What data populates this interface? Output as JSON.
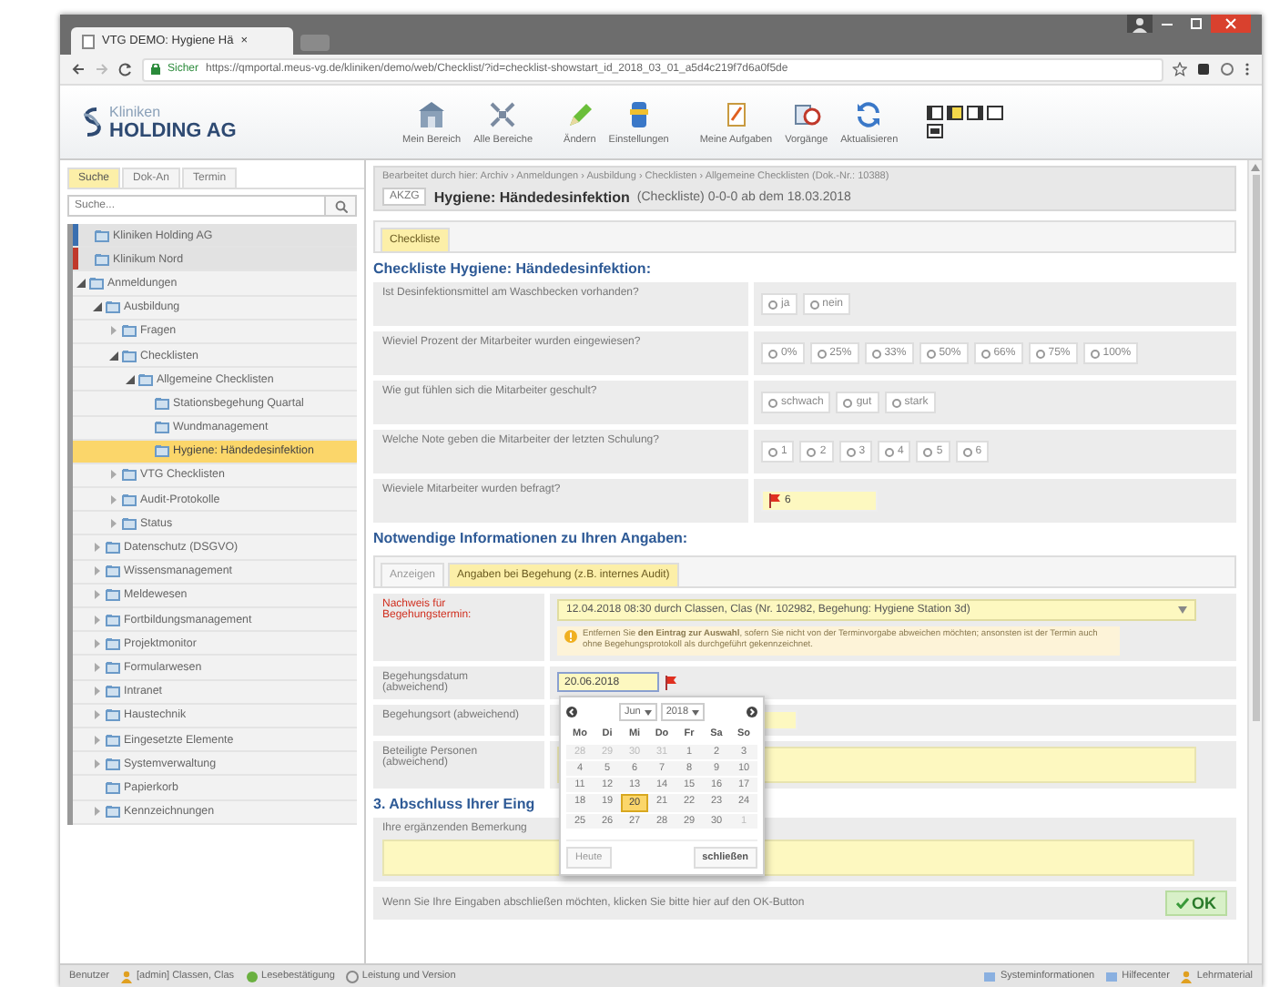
{
  "browser": {
    "tab_title": "VTG DEMO: Hygiene Hä",
    "tab_close": "×",
    "secure_label": "Sicher",
    "url": "https://qmportal.meus-vg.de/kliniken/demo/web/Checklist/?id=checklist-showstart_id_2018_03_01_a5d4c219f7d6a0f5de"
  },
  "header": {
    "logo_line1": "Kliniken",
    "logo_line2": "HOLDING AG",
    "toolbar": [
      {
        "label": "Mein Bereich"
      },
      {
        "label": "Alle Bereiche"
      },
      {
        "label": "Ändern"
      },
      {
        "label": "Einstellungen"
      },
      {
        "label": "Meine Aufgaben"
      },
      {
        "label": "Vorgänge"
      },
      {
        "label": "Aktualisieren"
      }
    ]
  },
  "sidebar": {
    "tabs": [
      {
        "label": "Suche",
        "selected": true
      },
      {
        "label": "Dok-An",
        "selected": false
      },
      {
        "label": "Termin",
        "selected": false
      }
    ],
    "search": {
      "placeholder": "Suche..."
    },
    "tree": [
      {
        "label": "Kliniken Holding AG",
        "selected": false,
        "color": "#3a6fb0"
      },
      {
        "label": "Klinikum Nord",
        "selected": false,
        "color": "#c0392b"
      },
      {
        "label": "Anmeldungen",
        "selected": false,
        "expanded": true,
        "children": [
          {
            "label": "Ausbildung",
            "selected": false,
            "expanded": true,
            "children": [
              {
                "label": "Fragen",
                "selected": false,
                "expanded": false
              },
              {
                "label": "Checklisten",
                "selected": false,
                "expanded": true,
                "children": [
                  {
                    "label": "Allgemeine Checklisten",
                    "selected": false,
                    "expanded": true,
                    "children": [
                      {
                        "label": "Stationsbegehung Quartal",
                        "selected": false
                      },
                      {
                        "label": "Wundmanagement",
                        "selected": false
                      },
                      {
                        "label": "Hygiene: Händedesinfektion",
                        "selected": true
                      }
                    ]
                  }
                ]
              },
              {
                "label": "VTG Checklisten",
                "selected": false,
                "expanded": false
              },
              {
                "label": "Audit-Protokolle",
                "selected": false,
                "expanded": false
              },
              {
                "label": "Status",
                "selected": false,
                "expanded": false
              }
            ]
          },
          {
            "label": "Datenschutz (DSGVO)",
            "selected": false,
            "expanded": false
          },
          {
            "label": "Wissensmanagement",
            "selected": false,
            "expanded": false
          },
          {
            "label": "Meldewesen",
            "selected": false,
            "expanded": false
          },
          {
            "label": "Fortbildungsmanagement",
            "selected": false,
            "expanded": false
          },
          {
            "label": "Projektmonitor",
            "selected": false,
            "expanded": false
          },
          {
            "label": "Formularwesen",
            "selected": false,
            "expanded": false
          },
          {
            "label": "Intranet",
            "selected": false,
            "expanded": false
          },
          {
            "label": "Haustechnik",
            "selected": false,
            "expanded": false
          },
          {
            "label": "Eingesetzte Elemente",
            "selected": false,
            "expanded": false
          },
          {
            "label": "Systemverwaltung",
            "selected": false,
            "expanded": false
          },
          {
            "label": "Papierkorb",
            "selected": false
          },
          {
            "label": "Kennzeichnungen",
            "selected": false,
            "expanded": false
          }
        ]
      }
    ]
  },
  "document": {
    "breadcrumb": "Bearbeitet durch hier: Archiv › Anmeldungen › Ausbildung › Checklisten › Allgemeine Checklisten (Dok.-Nr.: 10388)",
    "doc_code": "AKZG",
    "doc_title": "Hygiene: Händedesinfektion",
    "doc_meta": "(Checkliste) 0-0-0 ab dem 18.03.2018",
    "tabs": [
      {
        "label": "Checkliste",
        "selected": true
      }
    ],
    "section1_heading": "Checkliste Hygiene: Händedesinfektion:",
    "questions": [
      {
        "kind": "radio",
        "question": "Ist Desinfektionsmittel am Waschbecken vorhanden?",
        "options": [
          {
            "label": "ja",
            "selected": false
          },
          {
            "label": "nein",
            "selected": false
          }
        ]
      },
      {
        "kind": "radio",
        "question": "Wieviel Prozent der Mitarbeiter wurden eingewiesen?",
        "options": [
          {
            "label": "0%",
            "selected": false
          },
          {
            "label": "25%",
            "selected": false
          },
          {
            "label": "33%",
            "selected": false
          },
          {
            "label": "50%",
            "selected": false
          },
          {
            "label": "66%",
            "selected": false
          },
          {
            "label": "75%",
            "selected": false
          },
          {
            "label": "100%",
            "selected": false
          }
        ]
      },
      {
        "kind": "radio",
        "question": "Wie gut fühlen sich die Mitarbeiter geschult?",
        "options": [
          {
            "label": "schwach",
            "selected": false
          },
          {
            "label": "gut",
            "selected": false
          },
          {
            "label": "stark",
            "selected": false
          }
        ]
      },
      {
        "kind": "radio",
        "question": "Welche Note geben die Mitarbeiter der letzten Schulung?",
        "options": [
          {
            "label": "1",
            "selected": false
          },
          {
            "label": "2",
            "selected": false
          },
          {
            "label": "3",
            "selected": false
          },
          {
            "label": "4",
            "selected": false
          },
          {
            "label": "5",
            "selected": false
          },
          {
            "label": "6",
            "selected": false
          }
        ]
      },
      {
        "kind": "number",
        "question": "Wieviele Mitarbeiter wurden befragt?",
        "value": "6"
      }
    ],
    "section2_heading": "Notwendige Informationen zu Ihren Angaben:",
    "info_tabs": [
      {
        "label": "Anzeigen",
        "selected": false
      },
      {
        "label": "Angaben bei Begehung (z.B. internes Audit)",
        "selected": true
      }
    ],
    "info_fields": [
      {
        "kind": "select",
        "label": "Nachweis für Begehungstermin:",
        "required": true,
        "value": "12.04.2018 08:30 durch Classen, Clas (Nr. 102982, Begehung: Hygiene Station 3d)",
        "note": "Entfernen Sie **den Eintrag zur Auswahl**, sofern Sie nicht von der Terminvorgabe abweichen möchten; ansonsten ist der Termin auch ohne Begehungsprotokoll als durchgeführt gekennzeichnet."
      },
      {
        "kind": "date",
        "label": "Begehungsdatum (abweichend)",
        "required": false,
        "value": "20.06.2018"
      },
      {
        "kind": "text",
        "label": "Begehungsort (abweichend)",
        "required": false
      },
      {
        "kind": "textarea",
        "label": "Beteiligte Personen (abweichend)",
        "required": false
      }
    ],
    "datepicker": {
      "month": "Jun",
      "year": "2018",
      "weekdays": [
        "Mo",
        "Di",
        "Mi",
        "Do",
        "Fr",
        "Sa",
        "So"
      ],
      "weeks": [
        [
          {
            "day": "28",
            "other_month": true,
            "selected": false
          },
          {
            "day": "29",
            "other_month": true,
            "selected": false
          },
          {
            "day": "30",
            "other_month": true,
            "selected": false
          },
          {
            "day": "31",
            "other_month": true,
            "selected": false
          },
          {
            "day": "1",
            "other_month": false,
            "selected": false
          },
          {
            "day": "2",
            "other_month": false,
            "selected": false
          },
          {
            "day": "3",
            "other_month": false,
            "selected": false
          }
        ],
        [
          {
            "day": "4",
            "other_month": false,
            "selected": false
          },
          {
            "day": "5",
            "other_month": false,
            "selected": false
          },
          {
            "day": "6",
            "other_month": false,
            "selected": false
          },
          {
            "day": "7",
            "other_month": false,
            "selected": false
          },
          {
            "day": "8",
            "other_month": false,
            "selected": false
          },
          {
            "day": "9",
            "other_month": false,
            "selected": false
          },
          {
            "day": "10",
            "other_month": false,
            "selected": false
          }
        ],
        [
          {
            "day": "11",
            "other_month": false,
            "selected": false
          },
          {
            "day": "12",
            "other_month": false,
            "selected": false
          },
          {
            "day": "13",
            "other_month": false,
            "selected": false
          },
          {
            "day": "14",
            "other_month": false,
            "selected": false
          },
          {
            "day": "15",
            "other_month": false,
            "selected": false
          },
          {
            "day": "16",
            "other_month": false,
            "selected": false
          },
          {
            "day": "17",
            "other_month": false,
            "selected": false
          }
        ],
        [
          {
            "day": "18",
            "other_month": false,
            "selected": false
          },
          {
            "day": "19",
            "other_month": false,
            "selected": false
          },
          {
            "day": "20",
            "other_month": false,
            "selected": true
          },
          {
            "day": "21",
            "other_month": false,
            "selected": false
          },
          {
            "day": "22",
            "other_month": false,
            "selected": false
          },
          {
            "day": "23",
            "other_month": false,
            "selected": false
          },
          {
            "day": "24",
            "other_month": false,
            "selected": false
          }
        ],
        [
          {
            "day": "25",
            "other_month": false,
            "selected": false
          },
          {
            "day": "26",
            "other_month": false,
            "selected": false
          },
          {
            "day": "27",
            "other_month": false,
            "selected": false
          },
          {
            "day": "28",
            "other_month": false,
            "selected": false
          },
          {
            "day": "29",
            "other_month": false,
            "selected": false
          },
          {
            "day": "30",
            "other_month": false,
            "selected": false
          },
          {
            "day": "1",
            "other_month": true,
            "selected": false
          }
        ]
      ],
      "today_button": "Heute",
      "close_button": "schließen"
    },
    "section3_heading": "3. Abschluss Ihrer Eing",
    "remarks_label": "Ihre ergänzenden Bemerkung",
    "finish_text": "Wenn Sie Ihre Eingaben abschließen möchten, klicken Sie bitte hier auf den OK-Button",
    "ok_button": "OK"
  },
  "status_bar": {
    "left": [
      "Benutzer",
      "[admin] Classen, Clas",
      "Lesebestätigung",
      "Leistung und Version"
    ],
    "right": [
      "Systeminformationen",
      "Hilfecenter",
      "Lehrmaterial"
    ]
  }
}
